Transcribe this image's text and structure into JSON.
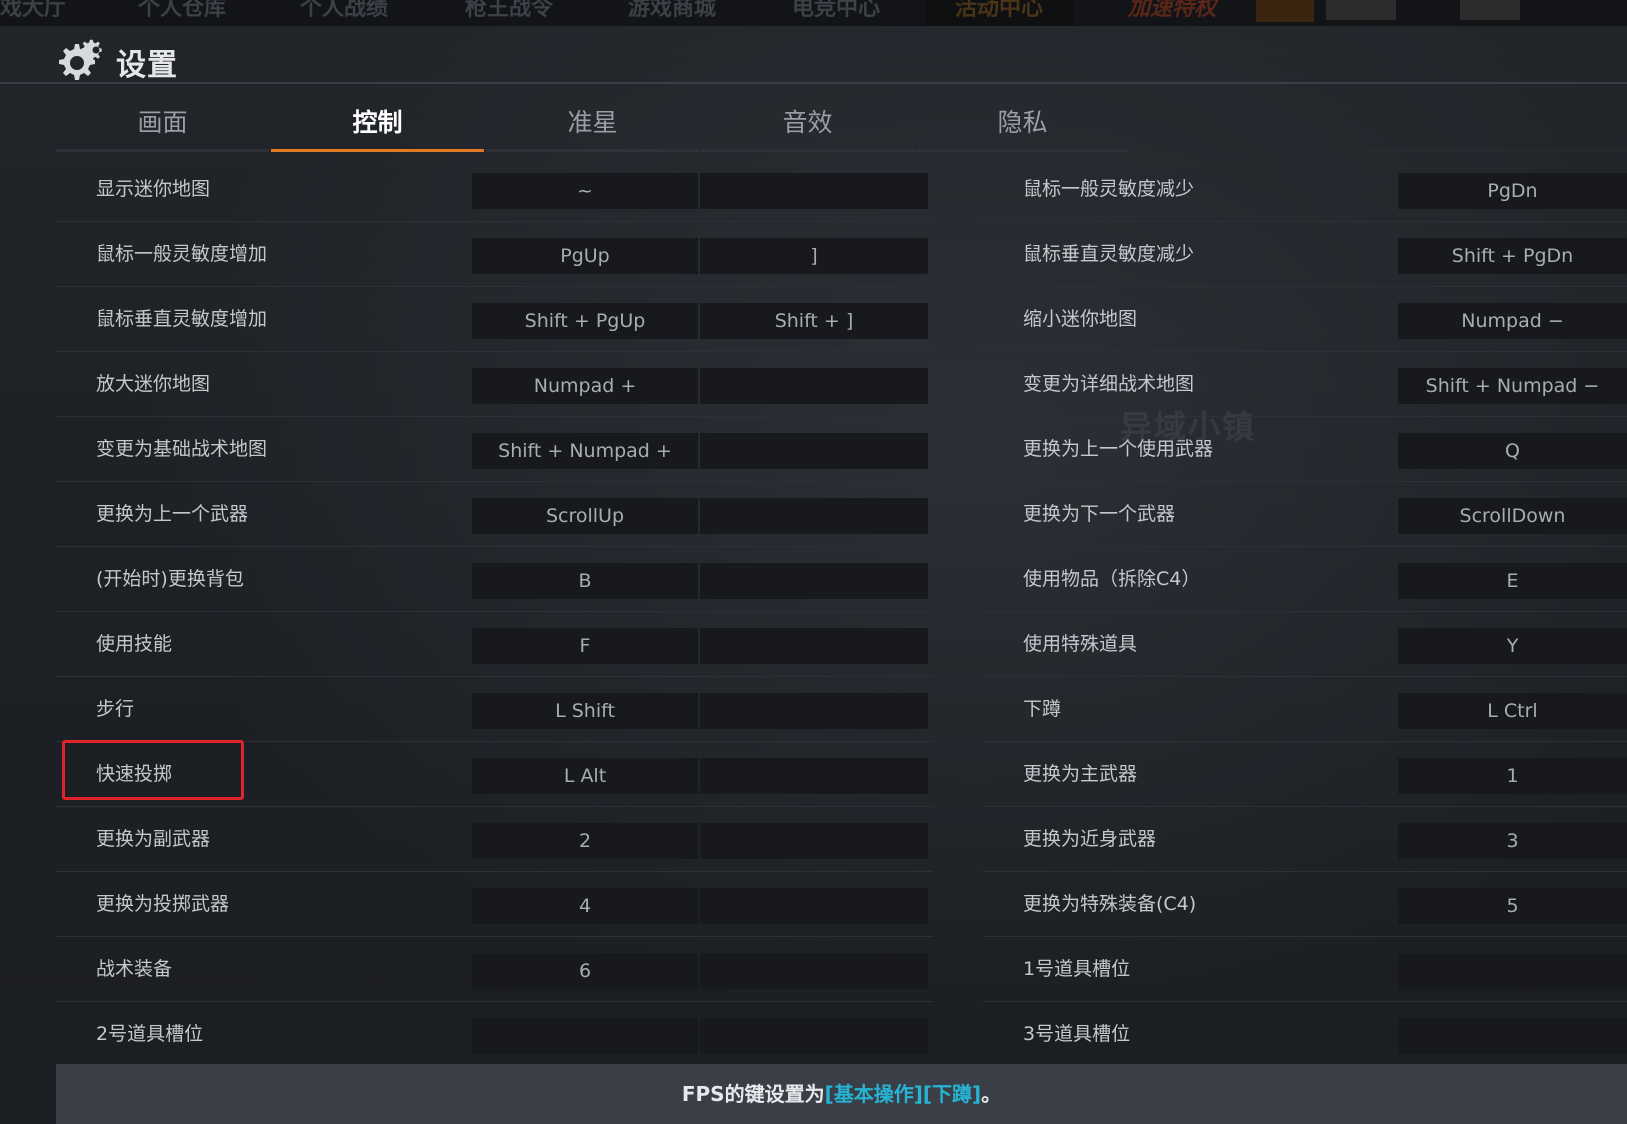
{
  "topnav": {
    "items": [
      "戏大厅",
      "个人仓库",
      "个人战绩",
      "枪王战令",
      "游戏商城",
      "电竞中心",
      "活动中心",
      "加速特权"
    ]
  },
  "header": {
    "title": "设置",
    "icon": "gear-icon"
  },
  "tabs": [
    {
      "label": "画面",
      "active": false
    },
    {
      "label": "控制",
      "active": true
    },
    {
      "label": "准星",
      "active": false
    },
    {
      "label": "音效",
      "active": false
    },
    {
      "label": "隐私",
      "active": false
    }
  ],
  "left_rows": [
    {
      "label": "显示迷你地图",
      "key1": "~",
      "key2": ""
    },
    {
      "label": "鼠标一般灵敏度增加",
      "key1": "PgUp",
      "key2": "]"
    },
    {
      "label": "鼠标垂直灵敏度增加",
      "key1": "Shift + PgUp",
      "key2": "Shift + ]"
    },
    {
      "label": "放大迷你地图",
      "key1": "Numpad +",
      "key2": ""
    },
    {
      "label": "变更为基础战术地图",
      "key1": "Shift + Numpad +",
      "key2": ""
    },
    {
      "label": "更换为上一个武器",
      "key1": "ScrollUp",
      "key2": ""
    },
    {
      "label": "(开始时)更换背包",
      "key1": "B",
      "key2": ""
    },
    {
      "label": "使用技能",
      "key1": "F",
      "key2": ""
    },
    {
      "label": "步行",
      "key1": "L Shift",
      "key2": ""
    },
    {
      "label": "快速投掷",
      "key1": "L Alt",
      "key2": ""
    },
    {
      "label": "更换为副武器",
      "key1": "2",
      "key2": ""
    },
    {
      "label": "更换为投掷武器",
      "key1": "4",
      "key2": ""
    },
    {
      "label": "战术装备",
      "key1": "6",
      "key2": ""
    },
    {
      "label": "2号道具槽位",
      "key1": "",
      "key2": ""
    }
  ],
  "right_rows": [
    {
      "label": "鼠标一般灵敏度减少",
      "key1": "PgDn"
    },
    {
      "label": "鼠标垂直灵敏度减少",
      "key1": "Shift + PgDn"
    },
    {
      "label": "缩小迷你地图",
      "key1": "Numpad −"
    },
    {
      "label": "变更为详细战术地图",
      "key1": "Shift + Numpad −"
    },
    {
      "label": "更换为上一个使用武器",
      "key1": "Q"
    },
    {
      "label": "更换为下一个武器",
      "key1": "ScrollDown"
    },
    {
      "label": "使用物品（拆除C4）",
      "key1": "E"
    },
    {
      "label": "使用特殊道具",
      "key1": "Y"
    },
    {
      "label": "下蹲",
      "key1": "L Ctrl"
    },
    {
      "label": "更换为主武器",
      "key1": "1"
    },
    {
      "label": "更换为近身武器",
      "key1": "3"
    },
    {
      "label": "更换为特殊装备(C4)",
      "key1": "5"
    },
    {
      "label": "1号道具槽位",
      "key1": ""
    },
    {
      "label": "3号道具槽位",
      "key1": ""
    }
  ],
  "watermark": "异域小镇",
  "footer": {
    "prefix": "FPS的键设置为",
    "accent": "[基本操作][下蹲]",
    "suffix": "。"
  },
  "colors": {
    "accent_tab": "#e07a25",
    "highlight": "#e0242c",
    "footer_accent": "#27b4d4"
  }
}
